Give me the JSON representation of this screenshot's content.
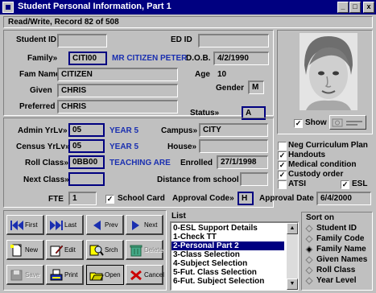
{
  "window": {
    "title": "Student Personal Information, Part 1",
    "minimize": "_",
    "maximize": "□",
    "close": "x"
  },
  "status": "Read/Write, Record 82 of 508",
  "fields": {
    "student_id_label": "Student ID",
    "student_id": "",
    "ed_id_label": "ED ID",
    "ed_id": "",
    "family_label": "Family»",
    "family": "CITI00",
    "family_name_display": "MR CITIZEN PETER",
    "dob_label": "D.O.B.",
    "dob": "4/2/1990",
    "fam_name_label": "Fam Name",
    "fam_name": "CITIZEN",
    "age_label": "Age",
    "age": "10",
    "given_label": "Given",
    "given": "CHRIS",
    "gender_label": "Gender",
    "gender": "M",
    "preferred_label": "Preferred",
    "preferred": "CHRIS",
    "status_label": "Status»",
    "status": "A",
    "admin_yrlv_label": "Admin YrLv»",
    "admin_yrlv": "05",
    "admin_yrlv_display": "YEAR 5",
    "campus_label": "Campus»",
    "campus": "CITY",
    "census_yrlv_label": "Census YrLv»",
    "census_yrlv": "05",
    "census_yrlv_display": "YEAR 5",
    "house_label": "House»",
    "house": "",
    "roll_class_label": "Roll Class»",
    "roll_class": "0BB00",
    "roll_class_display": "TEACHING ARE",
    "enrolled_label": "Enrolled",
    "enrolled": "27/1/1998",
    "next_class_label": "Next Class»",
    "next_class": "",
    "distance_label": "Distance from school",
    "distance": "",
    "fte_label": "FTE",
    "fte": "1",
    "school_card_label": "School Card",
    "approval_code_label": "Approval Code»",
    "approval_code": "H",
    "approval_date_label": "Approval Date",
    "approval_date": "6/4/2000"
  },
  "photo": {
    "show_label": "Show"
  },
  "checks": [
    {
      "label": "Neg Curriculum Plan",
      "checked": false
    },
    {
      "label": "Handouts",
      "checked": true
    },
    {
      "label": "Medical condition",
      "checked": true
    },
    {
      "label": "Custody order",
      "checked": true
    }
  ],
  "atsi_label": "ATSI",
  "esl_label": "ESL",
  "buttons": {
    "first": "First",
    "last": "Last",
    "prev": "Prev",
    "next": "Next",
    "new": "New",
    "edit": "Edit",
    "srch": "Srch",
    "delete": "Delete",
    "save": "Save",
    "print": "Print",
    "open": "Open",
    "cancel": "Cancel"
  },
  "list": {
    "title": "List",
    "items": [
      "0-ESL Support Details",
      "1-Check TT",
      "2-Personal Part 2",
      "3-Class Selection",
      "4-Subject Selection",
      "5-Fut. Class Selection",
      "6-Fut. Subject Selection"
    ],
    "selected_index": 2
  },
  "sort": {
    "title": "Sort on",
    "options": [
      "Student ID",
      "Family Code",
      "Family Name",
      "Given Names",
      "Roll Class",
      "Year Level"
    ],
    "selected_index": 2
  }
}
